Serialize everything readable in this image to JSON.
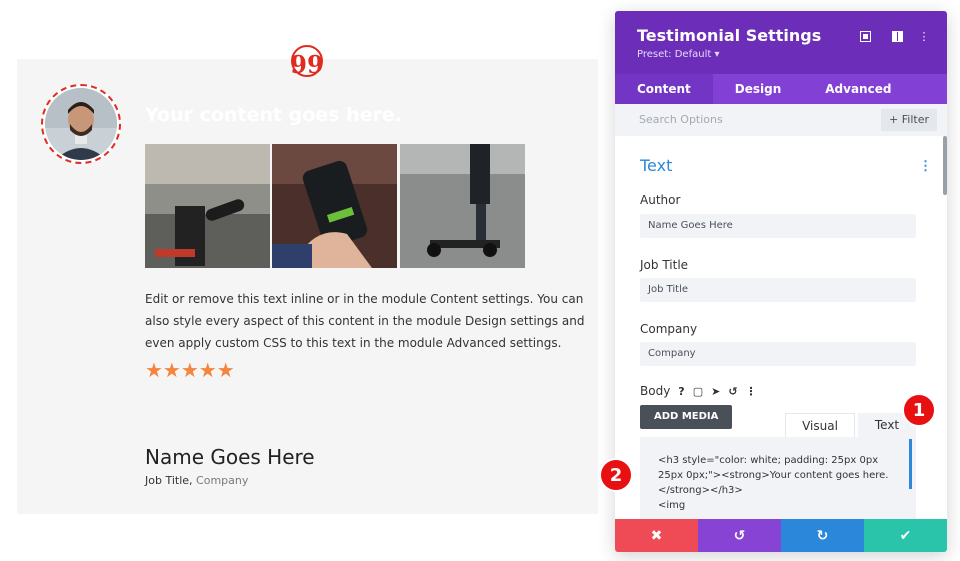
{
  "module": {
    "headline": "Your content goes here.",
    "body": "Edit or remove this text inline or in the module Content settings. You can also style every aspect of this content in the module Design settings and even apply custom CSS to this text in the module Advanced settings.",
    "stars": "★★★★★",
    "author": "Name Goes Here",
    "job_title": "Job Title",
    "separator": ", ",
    "company": "Company",
    "quote_glyph": "99"
  },
  "panel": {
    "title": "Testimonial Settings",
    "preset": "Preset: Default ▾",
    "header_icons": [
      "focus-icon",
      "columns-icon",
      "more-icon"
    ],
    "tabs": [
      {
        "label": "Content",
        "active": true
      },
      {
        "label": "Design",
        "active": false
      },
      {
        "label": "Advanced",
        "active": false
      }
    ],
    "search_placeholder": "Search Options",
    "filter_label": "+ Filter",
    "section_title": "Text",
    "fields": {
      "author_label": "Author",
      "author_value": "Name Goes Here",
      "job_label": "Job Title",
      "job_value": "Job Title",
      "company_label": "Company",
      "company_value": "Company"
    },
    "body_label": "Body",
    "body_icons": [
      "?",
      "▢",
      "➤",
      "↺",
      "⋮"
    ],
    "add_media": "ADD MEDIA",
    "editor_tabs": {
      "visual": "Visual",
      "text": "Text"
    },
    "code_lines": [
      "<h3 style=\"color: white; padding: 25px 0px",
      "25px 0px;\"><strong>Your content goes here.",
      "</strong></h3>",
      "<img"
    ],
    "bottom_buttons": [
      {
        "name": "cancel",
        "glyph": "✖",
        "color": "#ef4b57"
      },
      {
        "name": "undo",
        "glyph": "↺",
        "color": "#8744d4"
      },
      {
        "name": "redo",
        "glyph": "↻",
        "color": "#2b87da"
      },
      {
        "name": "save",
        "glyph": "✔",
        "color": "#29c4a9"
      }
    ]
  },
  "callouts": [
    "1",
    "2"
  ],
  "colors": {
    "accent_red": "#e02b20",
    "panel_purple": "#6c2eb9",
    "tab_purple": "#8240d4",
    "link_blue": "#2b87da",
    "star_orange": "#f5843f"
  }
}
